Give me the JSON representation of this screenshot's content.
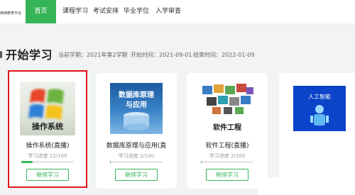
{
  "header": {
    "brand_text": "继续教育平台",
    "nav": [
      {
        "label": "首页",
        "active": true
      },
      {
        "label": "课程学习",
        "active": false
      },
      {
        "label": "考试安排",
        "active": false
      },
      {
        "label": "毕业学位",
        "active": false
      },
      {
        "label": "入学审查",
        "active": false
      }
    ]
  },
  "section": {
    "title": "开始学习",
    "current_term": "当前学期：2021年第2学期",
    "start_time": "开始时间：2021-09-01",
    "end_time": "结束时间：2022-01-09"
  },
  "courses": [
    {
      "name": "操作系统(直播)",
      "cover_text": "操作系统",
      "progress_text": "学习进度 22/100",
      "progress": 0.22,
      "button": "继续学习"
    },
    {
      "name": "数据库原理与应用(直",
      "cover_text_line1": "数据库原理",
      "cover_text_line2": "与应用",
      "progress_text": "学习进度 2/100",
      "progress": 0.02,
      "button": "继续学习"
    },
    {
      "name": "软件工程(直播)",
      "cover_text": "软件工程",
      "progress_text": "学习进度 2/100",
      "progress": 0.02,
      "button": "继续学习"
    },
    {
      "cover_text": "人工智能"
    }
  ],
  "colors": {
    "accent": "#35b558",
    "highlight": "#e0141b"
  }
}
